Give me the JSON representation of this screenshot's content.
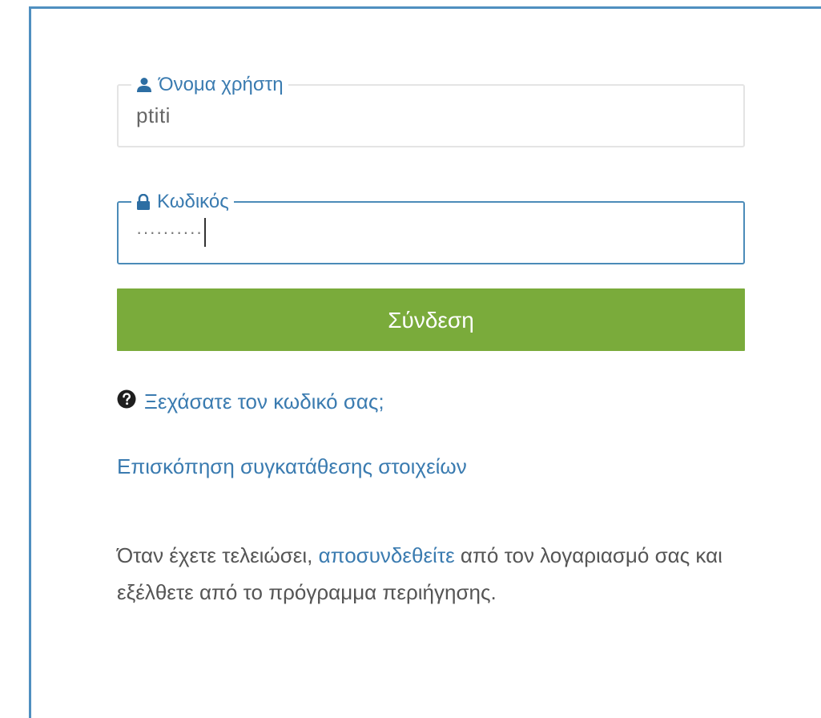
{
  "login_form": {
    "username": {
      "label": "Όνομα χρήστη",
      "value": "ptiti",
      "icon": "user-icon"
    },
    "password": {
      "label": "Κωδικός",
      "value": "··········",
      "icon": "lock-icon"
    },
    "submit_label": "Σύνδεση",
    "forgot_password": {
      "label": "Ξεχάσατε τον κωδικό σας;",
      "icon": "question-circle-icon"
    },
    "consent_link": "Επισκόπηση συγκατάθεσης στοιχείων",
    "logout_note": {
      "prefix": "Όταν έχετε τελειώσει, ",
      "link": "αποσυνδεθείτε",
      "suffix": " από τον λογαριασμό σας και εξέλθετε από το πρόγραμμα περιήγησης."
    }
  },
  "colors": {
    "accent_blue": "#3a7bb0",
    "panel_border": "#4f8fc0",
    "button_green": "#7aab3b",
    "field_border": "#e4e4e4",
    "focused_border": "#4b8bb8"
  }
}
